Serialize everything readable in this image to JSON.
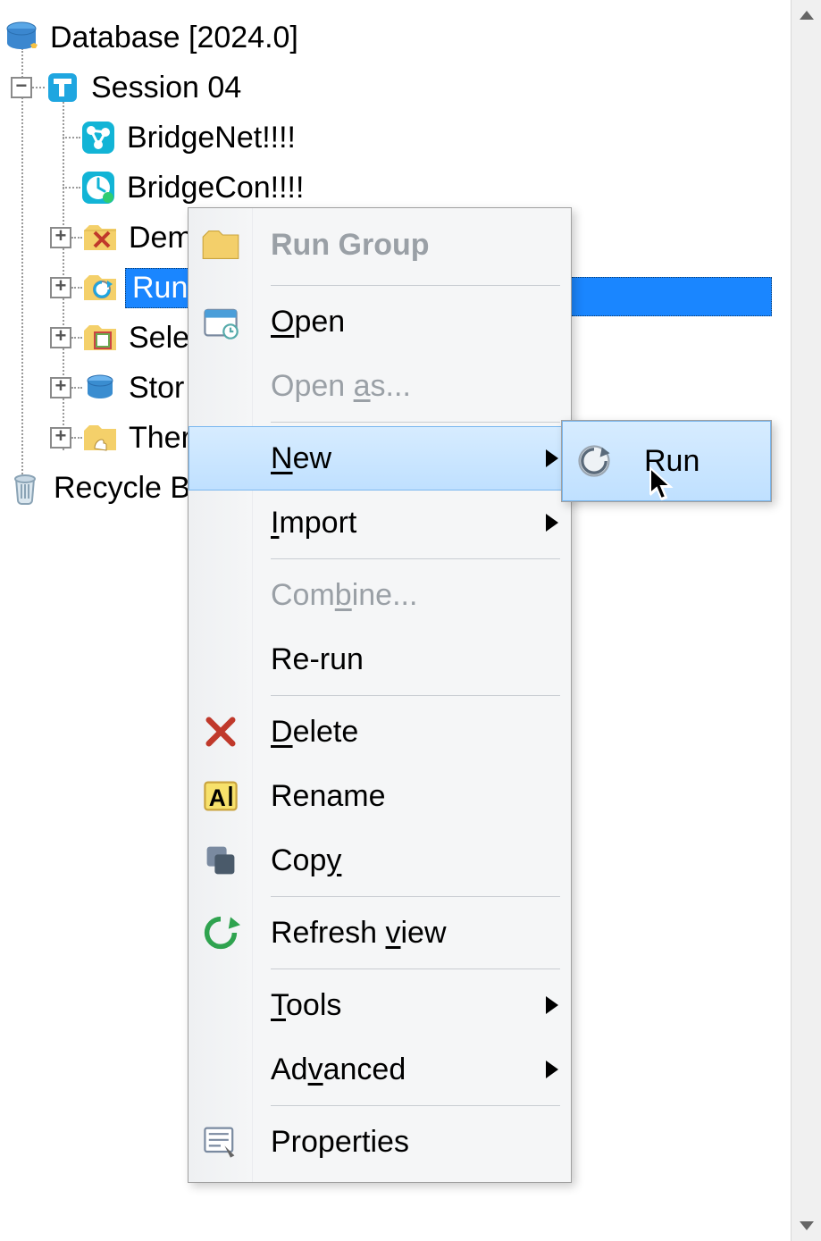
{
  "tree": {
    "root": {
      "label": "Database [2024.0]"
    },
    "session": {
      "label": "Session 04"
    },
    "items": {
      "bridgeNet": "BridgeNet!!!!",
      "bridgeCon": "BridgeCon!!!!",
      "dem": "Dem",
      "run": "Run",
      "sele": "Sele",
      "store": "Stor",
      "ther": "Ther"
    },
    "recycle": "Recycle Bi"
  },
  "menu": {
    "runGroup": "Run Group",
    "open": "Open",
    "openAs": "Open as...",
    "new": "New",
    "import": "Import",
    "combine": "Combine...",
    "rerun": "Re-run",
    "delete": "Delete",
    "rename": "Rename",
    "copy": "Copy",
    "refresh": "Refresh view",
    "tools": "Tools",
    "advanced": "Advanced",
    "properties": "Properties"
  },
  "submenu": {
    "run": "Run"
  },
  "underlines": {
    "open": "O",
    "openAs": "a",
    "new": "N",
    "import": "I",
    "combine": "b",
    "delete": "D",
    "copy": "y",
    "refresh": "v",
    "tools": "T",
    "advanced": "v"
  }
}
